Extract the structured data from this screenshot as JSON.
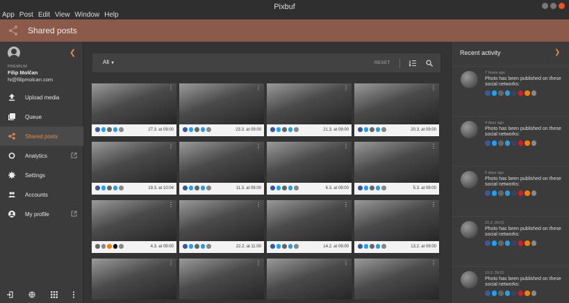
{
  "window": {
    "title": "Pixbuf"
  },
  "menu": [
    "App",
    "Post",
    "Edit",
    "View",
    "Window",
    "Help"
  ],
  "header": {
    "title": "Shared posts",
    "share_icon": "share-icon",
    "accent": "#8b5a4b"
  },
  "profile": {
    "plan": "PREMIUM",
    "name": "Filip Molčan",
    "email": "hi@filipmolcan.com"
  },
  "nav": [
    {
      "label": "Upload media",
      "icon": "upload-icon",
      "external": false,
      "active": false
    },
    {
      "label": "Queue",
      "icon": "queue-icon",
      "external": false,
      "active": false
    },
    {
      "label": "Shared posts",
      "icon": "share-icon",
      "external": false,
      "active": true
    },
    {
      "label": "Analytics",
      "icon": "analytics-icon",
      "external": true,
      "active": false
    },
    {
      "label": "Settings",
      "icon": "gear-icon",
      "external": false,
      "active": false
    },
    {
      "label": "Accounts",
      "icon": "accounts-icon",
      "external": false,
      "active": false
    },
    {
      "label": "My profile",
      "icon": "profile-icon",
      "external": true,
      "active": false
    }
  ],
  "toolbar": {
    "filter": "All",
    "reset": "RESET"
  },
  "posts": [
    {
      "date": "27.3. at 09:00",
      "networks": [
        "#3b5998",
        "#1da1f2",
        "#666",
        "#2d9cdb",
        "#888"
      ]
    },
    {
      "date": "23.3. at 09:00",
      "networks": [
        "#3b5998",
        "#1da1f2",
        "#666",
        "#2d9cdb",
        "#888"
      ]
    },
    {
      "date": "21.3. at 09:00",
      "networks": [
        "#3b5998",
        "#1da1f2",
        "#666",
        "#2d9cdb",
        "#888"
      ]
    },
    {
      "date": "20.3. at 09:00",
      "networks": [
        "#3b5998",
        "#1da1f2",
        "#666",
        "#2d9cdb",
        "#888"
      ]
    },
    {
      "date": "19.3. at 10:04",
      "networks": [
        "#3b5998",
        "#1da1f2",
        "#666",
        "#2d9cdb",
        "#888"
      ]
    },
    {
      "date": "11.3. at 09:00",
      "networks": [
        "#3b5998",
        "#1da1f2",
        "#666",
        "#2d9cdb",
        "#888"
      ]
    },
    {
      "date": "6.3. at 09:00",
      "networks": [
        "#3b5998",
        "#1da1f2",
        "#666",
        "#2d9cdb",
        "#888"
      ]
    },
    {
      "date": "5.3. at 09:00",
      "networks": [
        "#3b5998",
        "#1da1f2",
        "#666",
        "#2d9cdb",
        "#888"
      ]
    },
    {
      "date": "4.3. at 09:00",
      "networks": [
        "#666",
        "#888",
        "#f57d00",
        "#111",
        "#888"
      ]
    },
    {
      "date": "22.2. at 11:00",
      "networks": [
        "#3b5998",
        "#1da1f2",
        "#666",
        "#2d9cdb",
        "#888"
      ]
    },
    {
      "date": "14.2. at 09:00",
      "networks": [
        "#3b5998",
        "#1da1f2",
        "#666",
        "#2d9cdb",
        "#888"
      ]
    },
    {
      "date": "13.2. at 09:00",
      "networks": [
        "#3b5998",
        "#1da1f2",
        "#666",
        "#2d9cdb",
        "#888"
      ]
    },
    {
      "date": "",
      "networks": []
    },
    {
      "date": "",
      "networks": []
    },
    {
      "date": "",
      "networks": []
    },
    {
      "date": "",
      "networks": []
    }
  ],
  "activity": {
    "title": "Recent activity",
    "items": [
      {
        "time": "7 hours ago",
        "text": "Photo has been published on these social networks:"
      },
      {
        "time": "4 days ago",
        "text": "Photo has been published on these social networks:"
      },
      {
        "time": "6 days ago",
        "text": "Photo has been published on these social networks:"
      },
      {
        "time": "20.3. 09:01",
        "text": "Photo has been published on these social networks:"
      },
      {
        "time": "19.3. 09:01",
        "text": "Photo has been published on these social networks:"
      }
    ],
    "network_colors": [
      "#3b5998",
      "#1da1f2",
      "#666",
      "#2d9cdb",
      "#35465c",
      "#cb2027",
      "#f57d00",
      "#888"
    ]
  }
}
